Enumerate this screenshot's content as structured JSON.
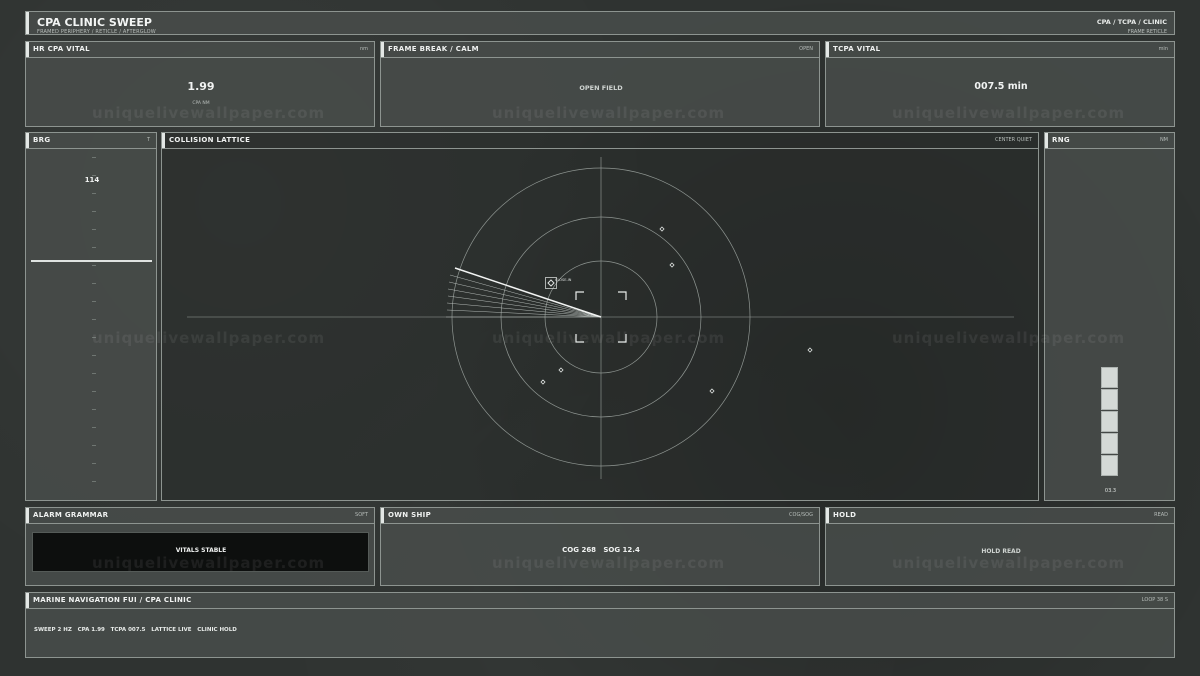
{
  "header": {
    "title": "CPA CLINIC SWEEP",
    "subtitle": "FRAMED PERIPHERY / RETICLE / AFTERGLOW",
    "breadcrumb": "CPA / TCPA / CLINIC",
    "breadcrumb_sub": "FRAME RETICLE"
  },
  "top_panels": {
    "cpa": {
      "title": "HR CPA VITAL",
      "tag": "nm",
      "value": "1.99",
      "caption": "CPA NM"
    },
    "frame": {
      "title": "FRAME BREAK / CALM",
      "tag": "OPEN",
      "value": "OPEN FIELD"
    },
    "tcpa": {
      "title": "TCPA VITAL",
      "tag": "min",
      "value": "007.5 min"
    }
  },
  "brg": {
    "title": "BRG",
    "tag": "T",
    "value": "114"
  },
  "lattice": {
    "title": "COLLISION LATTICE",
    "tag": "CENTER QUIET",
    "contact_label": "CLOSE-IN"
  },
  "rng": {
    "title": "RNG",
    "tag": "NM",
    "value": "03.3",
    "level": 0.72
  },
  "bottom_panels": {
    "alarm": {
      "title": "ALARM GRAMMAR",
      "tag": "SOFT",
      "value": "VITALS STABLE"
    },
    "own_ship": {
      "title": "OWN SHIP",
      "tag": "COG/SOG",
      "value": "COG 268   SOG 12.4"
    },
    "hold": {
      "title": "HOLD",
      "tag": "READ",
      "value": "HOLD READ"
    }
  },
  "footer": {
    "title": "MARINE NAVIGATION FUI / CPA CLINIC",
    "tag": "LOOP 38 S",
    "status": "SWEEP 2 HZ   CPA 1.99   TCPA 007.5   LATTICE LIVE   CLINIC HOLD"
  },
  "watermark": "uniquelivewallpaper.com",
  "colors": {
    "panel_border": "#8d9490",
    "panel_fill": "#484d4b",
    "accent": "#e3e7e5",
    "alarm_fill": "#0d0f0e"
  }
}
